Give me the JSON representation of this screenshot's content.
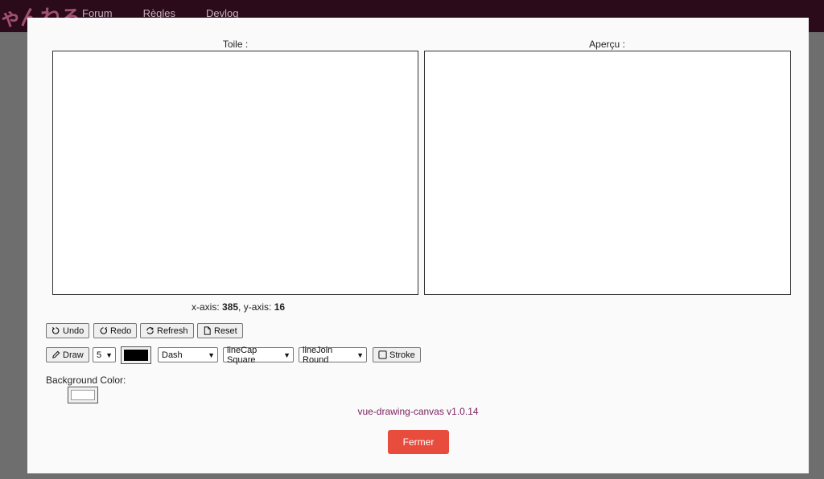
{
  "header": {
    "logo_text": "ゃんねる",
    "nav": [
      {
        "label": "Forum"
      },
      {
        "label": "Règles"
      },
      {
        "label": "Devlog"
      }
    ]
  },
  "modal": {
    "canvas_label": "Toile :",
    "preview_label": "Aperçu :",
    "coords": {
      "x_label": "x-axis: ",
      "x_value": "385",
      "y_label": ", y-axis: ",
      "y_value": "16"
    },
    "toolbar1": {
      "undo": "Undo",
      "redo": "Redo",
      "refresh": "Refresh",
      "reset": "Reset"
    },
    "toolbar2": {
      "draw": "Draw",
      "line_width": "5",
      "stroke_color": "#000000",
      "line_style": "Dash",
      "line_cap": "lineCap Square",
      "line_join": "lineJoin Round",
      "stroke": "Stroke"
    },
    "background": {
      "label": "Background Color:",
      "color": "#ffffff"
    },
    "version": "vue-drawing-canvas v1.0.14",
    "close": "Fermer"
  },
  "colors": {
    "accent": "#e74c3c",
    "topbar": "#2b0a1a",
    "version_text": "#7a1f5e"
  }
}
